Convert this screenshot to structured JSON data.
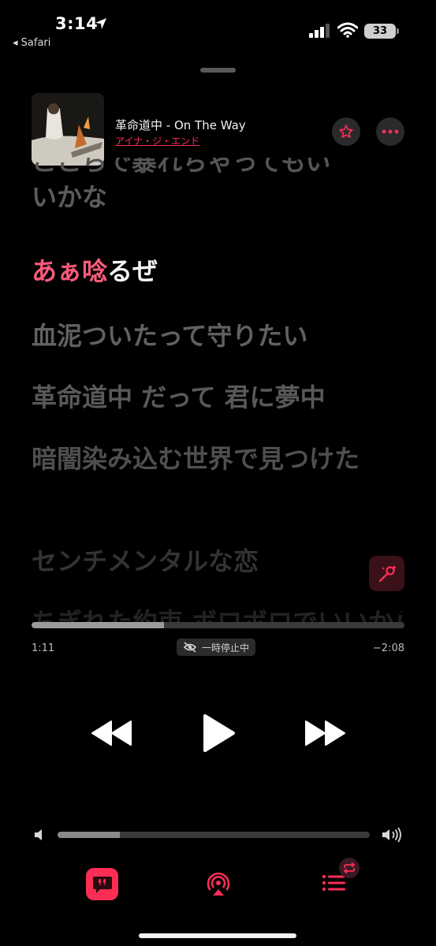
{
  "status_bar": {
    "time": "3:14",
    "back_app": "◂ Safari",
    "battery": "33"
  },
  "now_playing": {
    "title": "革命道中 - On The Way",
    "artist": "アイナ・ジ・エンド"
  },
  "lyrics": {
    "previous_cut": "ここらで暴れちゃってもい",
    "previous": "いかな",
    "active_sung": "あぁ唸",
    "active_unsung": "るぜ",
    "line_1": "血泥ついたって守りたい",
    "line_2": "革命道中 だって 君に夢中",
    "line_3": "暗闇染み込む世界で見つけた",
    "line_4": "センチメンタルな恋",
    "line_5": "ちぎれた約束 ボロボロでいいから"
  },
  "playback": {
    "elapsed": "1:11",
    "remaining": "−2:08",
    "paused_label": "一時停止中",
    "progress": 0.355
  },
  "volume": {
    "level": 0.2
  },
  "colors": {
    "accent": "#fa2d55",
    "background": "#000000"
  },
  "icons": [
    "location-arrow-icon",
    "signal-icon",
    "wifi-icon",
    "star-icon",
    "more-icon",
    "sing-icon",
    "rewind-icon",
    "play-icon",
    "fast-forward-icon",
    "volume-low-icon",
    "volume-high-icon",
    "lyrics-icon",
    "airplay-icon",
    "queue-icon",
    "repeat-icon"
  ]
}
